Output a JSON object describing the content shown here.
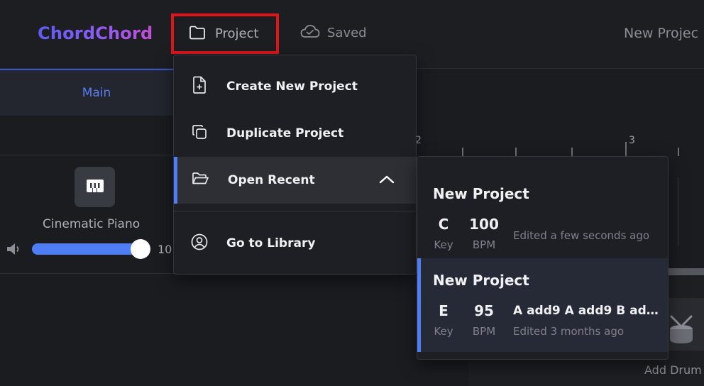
{
  "header": {
    "logo": "ChordChord",
    "project_label": "Project",
    "saved_label": "Saved",
    "project_title": "New Projec"
  },
  "left_panel": {
    "tab_main": "Main",
    "instrument_name": "Cinematic Piano",
    "volume_value": "10"
  },
  "timeline": {
    "ruler_labels": [
      "2",
      "3"
    ]
  },
  "project_menu": {
    "items": [
      {
        "label": "Create New Project",
        "icon": "file-plus-icon"
      },
      {
        "label": "Duplicate Project",
        "icon": "copy-icon"
      },
      {
        "label": "Open Recent",
        "icon": "folder-open-icon",
        "expanded": true
      },
      {
        "label": "Go to Library",
        "icon": "user-circle-icon"
      }
    ]
  },
  "recent_projects": [
    {
      "title": "New Project",
      "key": "C",
      "key_caption": "Key",
      "bpm": "100",
      "bpm_caption": "BPM",
      "edited": "Edited a few seconds ago",
      "chords": ""
    },
    {
      "title": "New Project",
      "key": "E",
      "key_caption": "Key",
      "bpm": "95",
      "bpm_caption": "BPM",
      "edited": "Edited 3 months ago",
      "chords": "A add9 A add9 B add…"
    }
  ],
  "drums": {
    "add_label": "Add Drum"
  },
  "colors": {
    "accent": "#4f7df5",
    "highlight_border": "#e0141b",
    "background": "#1b1c20"
  }
}
